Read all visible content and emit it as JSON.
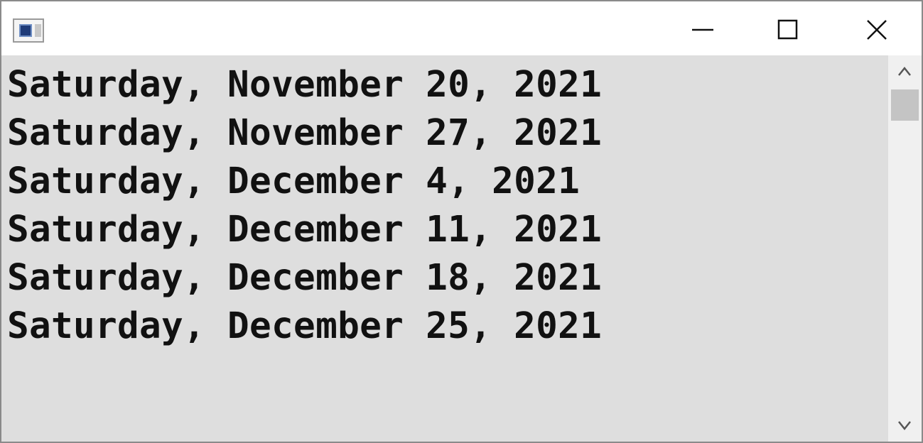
{
  "window": {
    "icon": "console-app-icon",
    "controls": {
      "minimize": "minimize-icon",
      "maximize": "maximize-icon",
      "close": "close-icon"
    }
  },
  "console": {
    "lines": [
      "Saturday, November 20, 2021",
      "Saturday, November 27, 2021",
      "Saturday, December 4, 2021",
      "Saturday, December 11, 2021",
      "Saturday, December 18, 2021",
      "Saturday, December 25, 2021"
    ]
  },
  "scrollbar": {
    "up": "chevron-up-icon",
    "down": "chevron-down-icon"
  },
  "colors": {
    "console_background": "#dedede",
    "console_text": "#111111",
    "scroll_thumb": "#c4c4c4"
  }
}
